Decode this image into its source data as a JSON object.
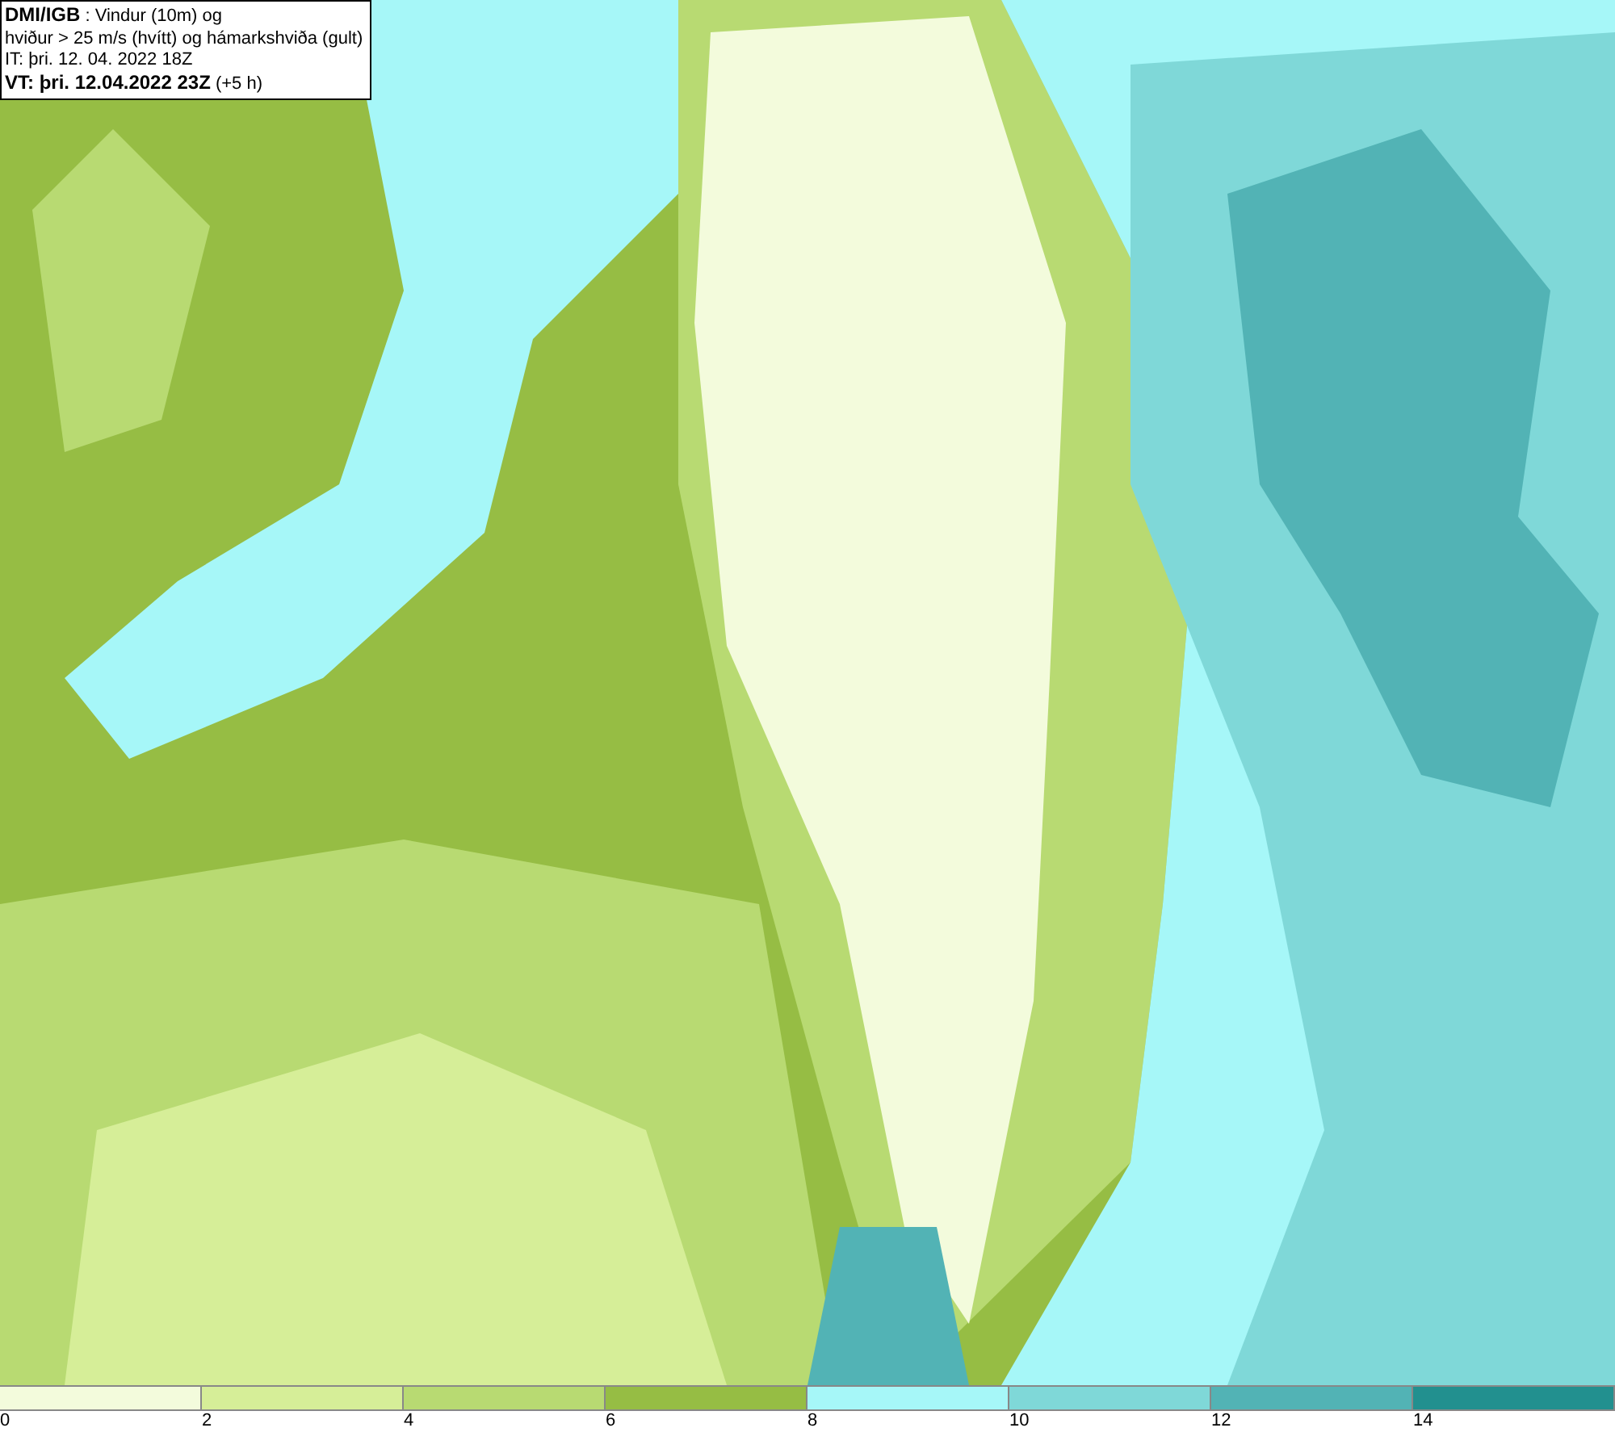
{
  "info_box": {
    "lines": [
      "**DMI/IGB** : Vindur (10m) og",
      "hviður > 25 m/s (hvítt) og hámarkshviða (gult)",
      "IT: þri. 12. 04. 2022 18Z",
      "**VT: þri. 12.04.2022 23Z** (+5 h)"
    ]
  },
  "legend": [
    {
      "label": "0",
      "color": "#f3fbdc"
    },
    {
      "label": "2",
      "color": "#d6ee98"
    },
    {
      "label": "4",
      "color": "#b8da72"
    },
    {
      "label": "6",
      "color": "#96bd44"
    },
    {
      "label": "8",
      "color": "#a6f7f8"
    },
    {
      "label": "10",
      "color": "#7fd8d8"
    },
    {
      "label": "12",
      "color": "#52b3b5"
    },
    {
      "label": "14",
      "color": "#22908f"
    }
  ]
}
